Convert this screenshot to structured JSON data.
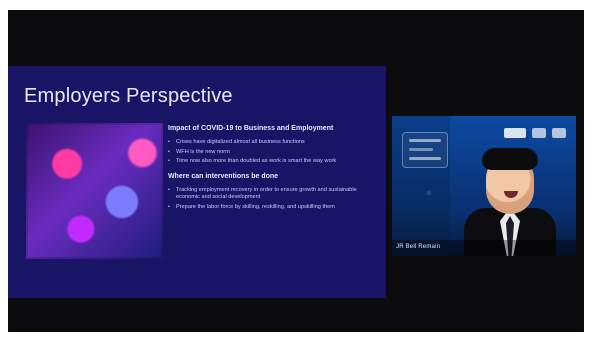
{
  "slide": {
    "title": "Employers Perspective",
    "sections": [
      {
        "heading": "Impact of COVID-19 to Business and Employment",
        "bullets": [
          "Crises have digitalized almost all business functions",
          "WFH is the new norm",
          "Time now also more than doubled as work is smart the way work"
        ]
      },
      {
        "heading": "Where can interventions be done",
        "bullets": [
          "Tracking employment recovery in order to ensure growth and sustainable economic and social development",
          "Prepare the labor force by skilling, reskilling, and upskilling them"
        ]
      }
    ]
  },
  "video": {
    "speaker_name": "JR Bell Remain"
  }
}
